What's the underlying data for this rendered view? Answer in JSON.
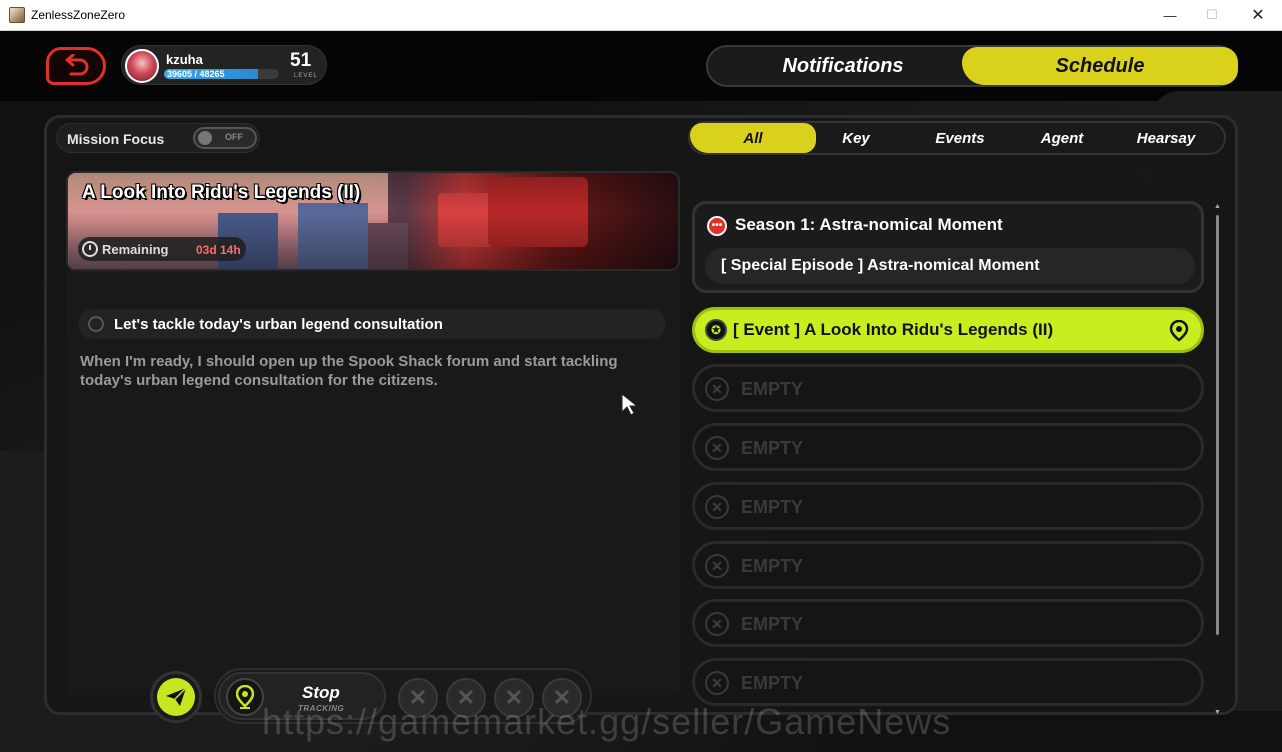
{
  "window": {
    "title": "ZenlessZoneZero",
    "minimize_glyph": "—",
    "maximize_glyph": "☐",
    "close_glyph": "✕"
  },
  "profile": {
    "username": "kzuha",
    "xp_text": "39605 / 48265",
    "xp_fraction": 0.82,
    "level": "51",
    "level_label": "LEVEL"
  },
  "top_nav": {
    "tabs": [
      {
        "label": "Notifications",
        "active": false
      },
      {
        "label": "Schedule",
        "active": true
      }
    ]
  },
  "mission_focus": {
    "label": "Mission Focus",
    "toggle_state": "OFF"
  },
  "filters": [
    {
      "label": "All",
      "active": true
    },
    {
      "label": "Key",
      "active": false
    },
    {
      "label": "Events",
      "active": false
    },
    {
      "label": "Agent",
      "active": false
    },
    {
      "label": "Hearsay",
      "active": false
    }
  ],
  "detail": {
    "title": "A Look Into Ridu's Legends (II)",
    "remaining_label": "Remaining",
    "remaining_time": "03d 14h",
    "task": "Let's tackle today's urban legend consultation",
    "description": "When I'm ready, I should open up the Spook Shack forum and start tackling today's urban legend consultation for the citizens."
  },
  "tracking": {
    "stop_label": "Stop",
    "tracking_label": "TRACKING",
    "slot_glyph": "✕"
  },
  "mission_list": {
    "season": {
      "icon_glyph": "•••",
      "title": "Season 1: Astra-nomical Moment",
      "subtitle": "[ Special Episode ] Astra-nomical Moment"
    },
    "event": {
      "icon_glyph": "✪",
      "label": "[ Event ] A Look Into Ridu's Legends (II)"
    },
    "empty_glyph": "✕",
    "empty_slots": [
      "EMPTY",
      "EMPTY",
      "EMPTY",
      "EMPTY",
      "EMPTY",
      "EMPTY"
    ]
  },
  "scrollbar": {
    "up_glyph": "▲",
    "down_glyph": "▼"
  },
  "watermark": "https://gamemarket.gg/seller/GameNews",
  "colors": {
    "accent_yellow": "#d9d11b",
    "event_green": "#c8ee20",
    "back_red": "#e0302a",
    "xp_blue": "#3aa8e8",
    "remaining_red": "#ff6a6a"
  }
}
